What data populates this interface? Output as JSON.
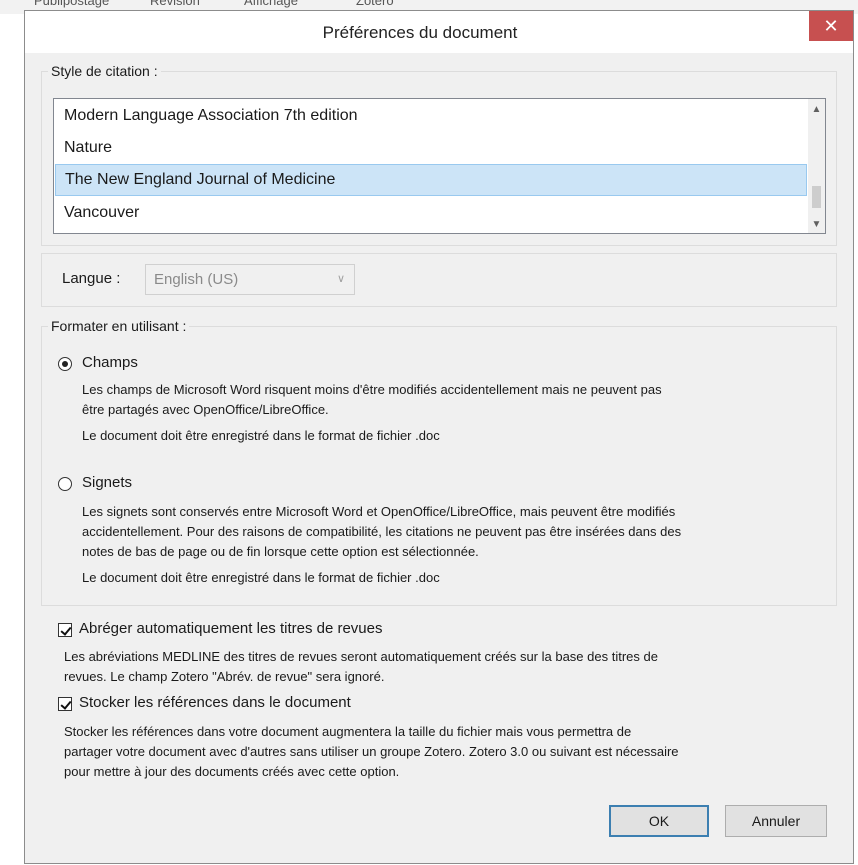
{
  "dialog": {
    "title": "Préférences du document",
    "close_glyph": "✕"
  },
  "citation_style": {
    "legend": "Style de citation :",
    "items": [
      {
        "label": "Modern Language Association 7th edition",
        "selected": false
      },
      {
        "label": "Nature",
        "selected": false
      },
      {
        "label": "The New England Journal of Medicine",
        "selected": true
      },
      {
        "label": "Vancouver",
        "selected": false
      }
    ]
  },
  "language": {
    "label": "Langue :",
    "value": "English (US)"
  },
  "format": {
    "legend": "Formater en utilisant :",
    "fields": {
      "label": "Champs",
      "selected": true,
      "desc1": "Les champs de Microsoft Word risquent moins d'être modifiés accidentellement mais ne peuvent pas",
      "desc2": "être partagés avec OpenOffice/LibreOffice.",
      "note": "Le document doit être enregistré dans le format de fichier .doc"
    },
    "bookmarks": {
      "label": "Signets",
      "selected": false,
      "desc1": "Les signets sont conservés entre Microsoft Word et OpenOffice/LibreOffice, mais peuvent être modifiés",
      "desc2": "accidentellement. Pour des raisons de compatibilité, les citations ne peuvent pas être insérées dans des",
      "desc3": "notes de bas de page ou de fin lorsque cette option est sélectionnée.",
      "note": "Le document doit être enregistré dans le format de fichier .doc"
    }
  },
  "abbreviate": {
    "label": "Abréger automatiquement les titres de revues",
    "checked": true,
    "desc1": "Les abréviations MEDLINE des titres de revues seront automatiquement créés sur la base des titres de",
    "desc2": "revues. Le champ Zotero \"Abrév. de revue\" sera ignoré."
  },
  "store": {
    "label": "Stocker les références dans le document",
    "checked": true,
    "desc1": "Stocker les références dans votre document augmentera la taille du fichier mais vous permettra de",
    "desc2": "partager votre document avec d'autres sans utiliser un groupe Zotero. Zotero 3.0 ou suivant est nécessaire",
    "desc3": "pour mettre à jour des documents créés avec cette option."
  },
  "buttons": {
    "ok": "OK",
    "cancel": "Annuler"
  },
  "background_strip": [
    "Publipostage",
    "Révision",
    "Affichage",
    "Zotero"
  ]
}
